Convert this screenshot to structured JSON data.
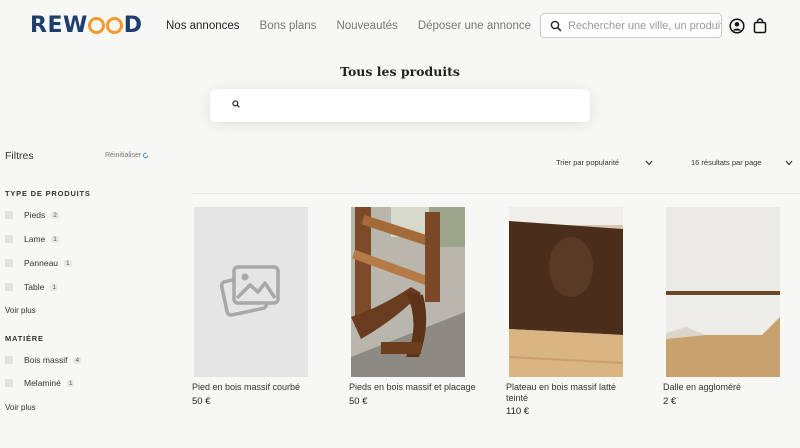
{
  "brand": {
    "logo_prefix": "REW",
    "logo_suffix": "D",
    "logo_color": "#1e3e6d",
    "accent": "#f29a2e"
  },
  "nav": [
    {
      "label": "Nos annonces",
      "active": true
    },
    {
      "label": "Bons plans"
    },
    {
      "label": "Nouveautés"
    },
    {
      "label": "Déposer une annonce"
    }
  ],
  "header": {
    "search_placeholder": "Rechercher une ville, un produit...",
    "icons": [
      "search-icon",
      "user-icon",
      "shopping-bag-icon"
    ]
  },
  "page": {
    "title": "Tous les produits"
  },
  "filters": {
    "title": "Filtres",
    "reset": "Réinitialiser",
    "groups": [
      {
        "title": "TYPE DE PRODUITS",
        "items": [
          {
            "label": "Pieds",
            "count": "2"
          },
          {
            "label": "Lame",
            "count": "1"
          },
          {
            "label": "Panneau",
            "count": "1"
          },
          {
            "label": "Table",
            "count": "1"
          }
        ],
        "more": "Voir plus"
      },
      {
        "title": "MATIÈRE",
        "items": [
          {
            "label": "Bois massif",
            "count": "4"
          },
          {
            "label": "Melaminé",
            "count": "1"
          }
        ],
        "more": "Voir plus"
      }
    ]
  },
  "toolbar": {
    "sort": "Trier par popularité",
    "per_page": "16 résultats par page"
  },
  "products": [
    {
      "name": "Pied en bois massif courbé",
      "price": "50 €"
    },
    {
      "name": "Pieds en bois massif et placage",
      "price": "50 €"
    },
    {
      "name": "Plateau en bois massif latté teinté",
      "price": "110 €"
    },
    {
      "name": "Dalle en aggloméré",
      "price": "2 €"
    }
  ]
}
